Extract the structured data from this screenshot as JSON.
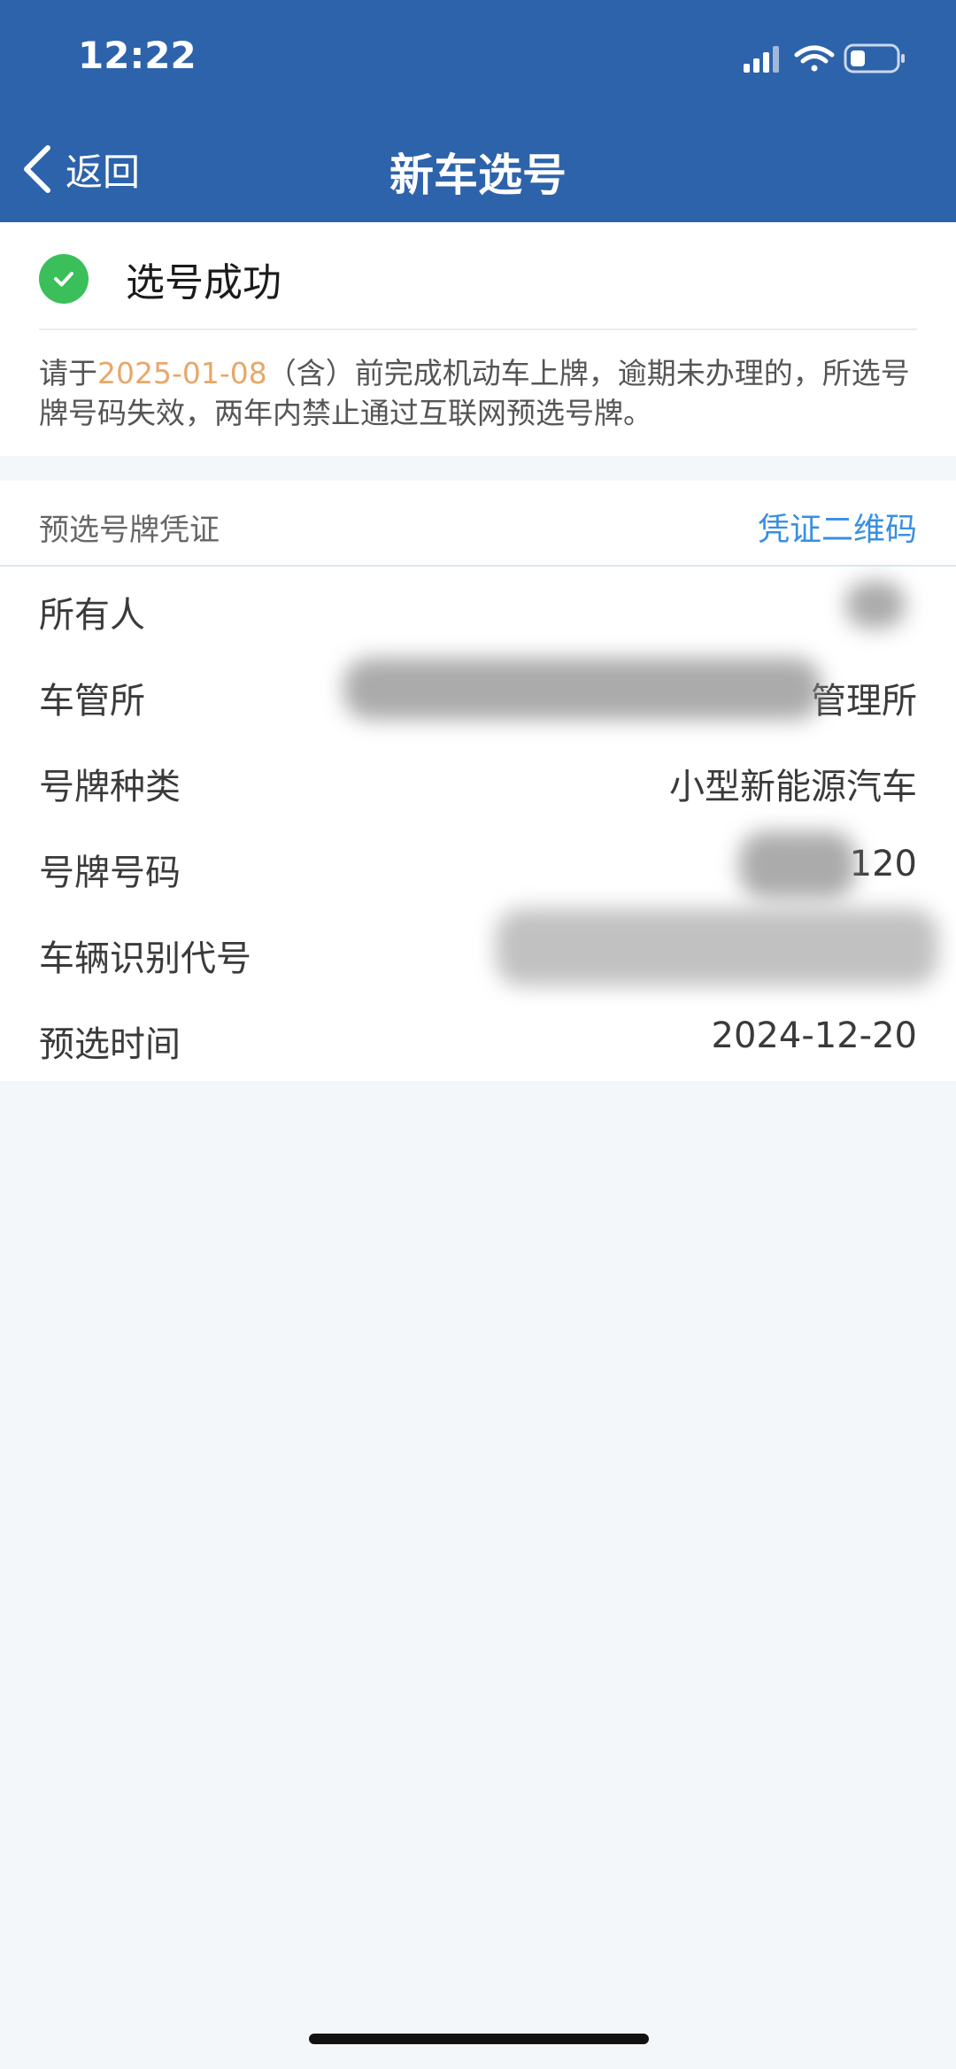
{
  "status_bar": {
    "time": "12:22"
  },
  "nav": {
    "back_label": "返回",
    "title": "新车选号"
  },
  "result": {
    "title": "选号成功",
    "notice_pre": "请于",
    "notice_date": "2025-01-08",
    "notice_post": "（含）前完成机动车上牌，逾期未办理的，所选号牌号码失效，两年内禁止通过互联网预选号牌。"
  },
  "voucher": {
    "title": "预选号牌凭证",
    "qr_link": "凭证二维码",
    "rows": [
      {
        "label": "所有人",
        "value": ""
      },
      {
        "label": "车管所",
        "value": "管理所"
      },
      {
        "label": "号牌种类",
        "value": "小型新能源汽车"
      },
      {
        "label": "号牌号码",
        "value": "120"
      },
      {
        "label": "车辆识别代号",
        "value": ""
      },
      {
        "label": "预选时间",
        "value": "2024-12-20"
      }
    ]
  },
  "colors": {
    "header_bg": "#2d63ab",
    "success": "#3bbf5a",
    "date_highlight": "#e8a76a",
    "link": "#3a8fe0"
  }
}
